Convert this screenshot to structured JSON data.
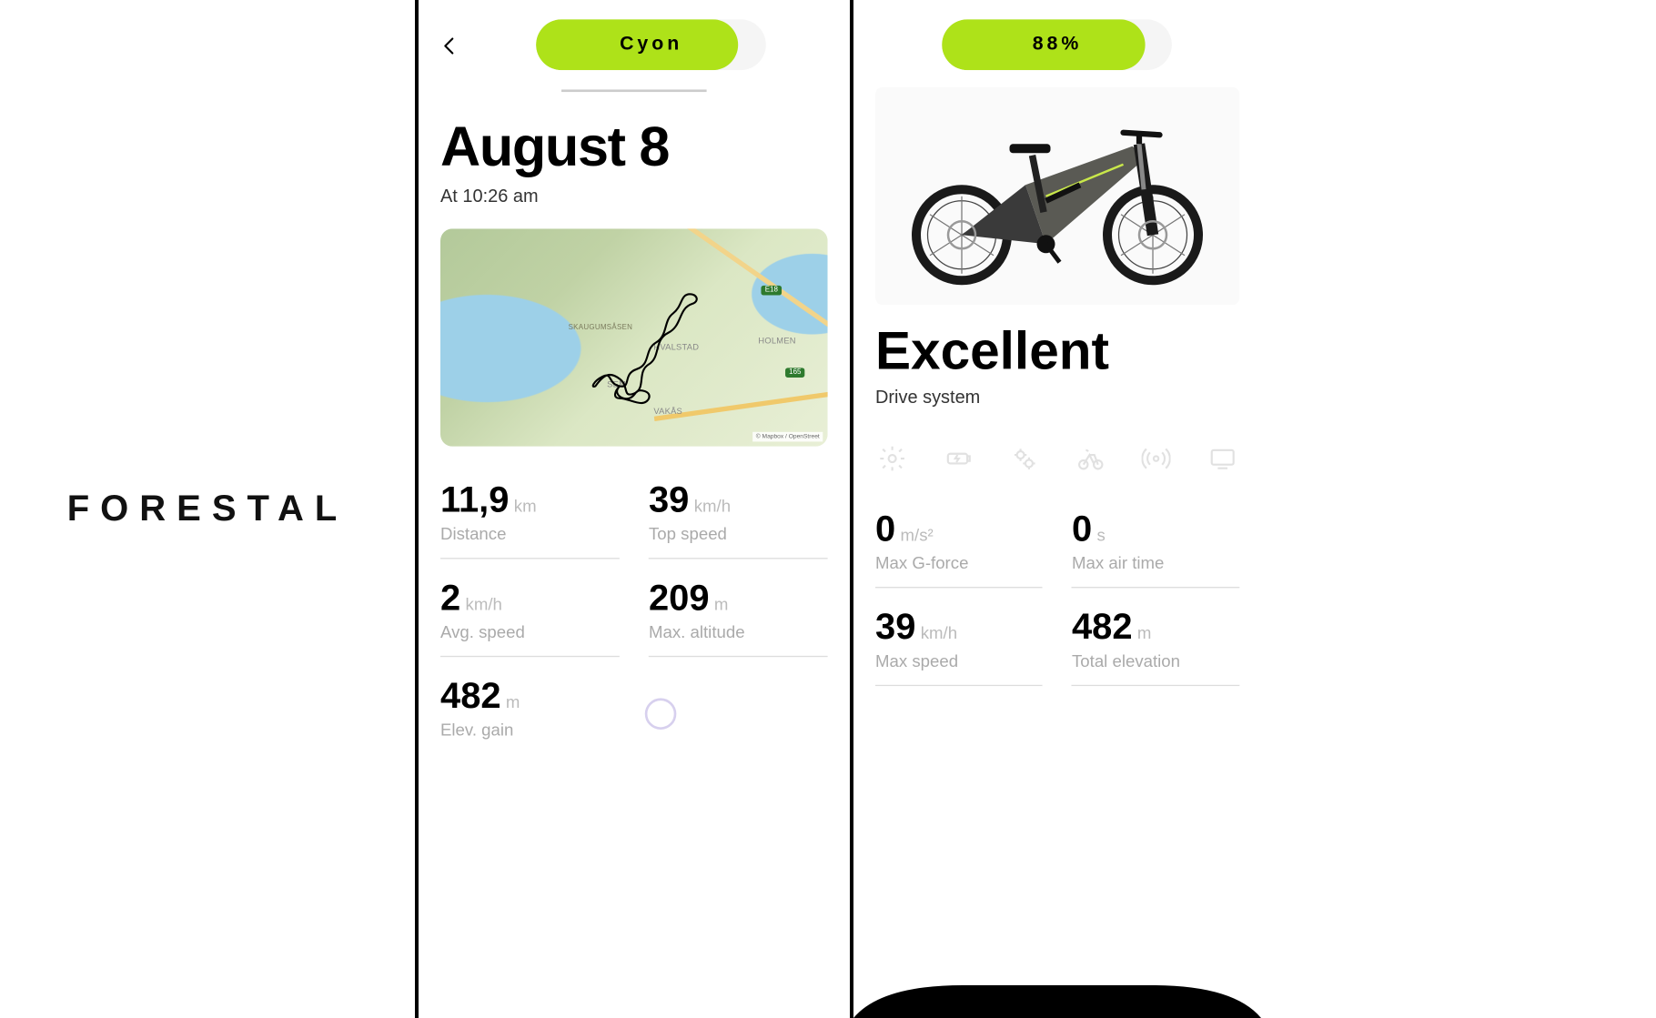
{
  "brand": "FORESTAL",
  "ride": {
    "header_pill": "Cyon",
    "date_title": "August 8",
    "time_line": "At 10:26 am",
    "map": {
      "place1": "Skaugumsåsen",
      "place2": "HVALSTAD",
      "place3": "HOLMEN",
      "place4": "SEM",
      "place5": "VAKÅS",
      "shield1": "E18",
      "shield2": "165",
      "attribution": "© Mapbox / OpenStreet"
    },
    "stats": [
      {
        "value": "11,9",
        "unit": "km",
        "label": "Distance"
      },
      {
        "value": "39",
        "unit": "km/h",
        "label": "Top speed"
      },
      {
        "value": "2",
        "unit": "km/h",
        "label": "Avg. speed"
      },
      {
        "value": "209",
        "unit": "m",
        "label": "Max. altitude"
      },
      {
        "value": "482",
        "unit": "m",
        "label": "Elev. gain"
      }
    ]
  },
  "status": {
    "battery_label": "88%",
    "battery_fill_percent": 88,
    "status_title": "Excellent",
    "status_sub": "Drive system",
    "icons": [
      "gear-icon",
      "battery-icon",
      "gears-icon",
      "bike-icon",
      "signal-icon",
      "display-icon"
    ],
    "stats": [
      {
        "value": "0",
        "unit": "m/s²",
        "label": "Max G-force"
      },
      {
        "value": "0",
        "unit": "s",
        "label": "Max air time"
      },
      {
        "value": "39",
        "unit": "km/h",
        "label": "Max speed"
      },
      {
        "value": "482",
        "unit": "m",
        "label": "Total elevation"
      }
    ]
  }
}
